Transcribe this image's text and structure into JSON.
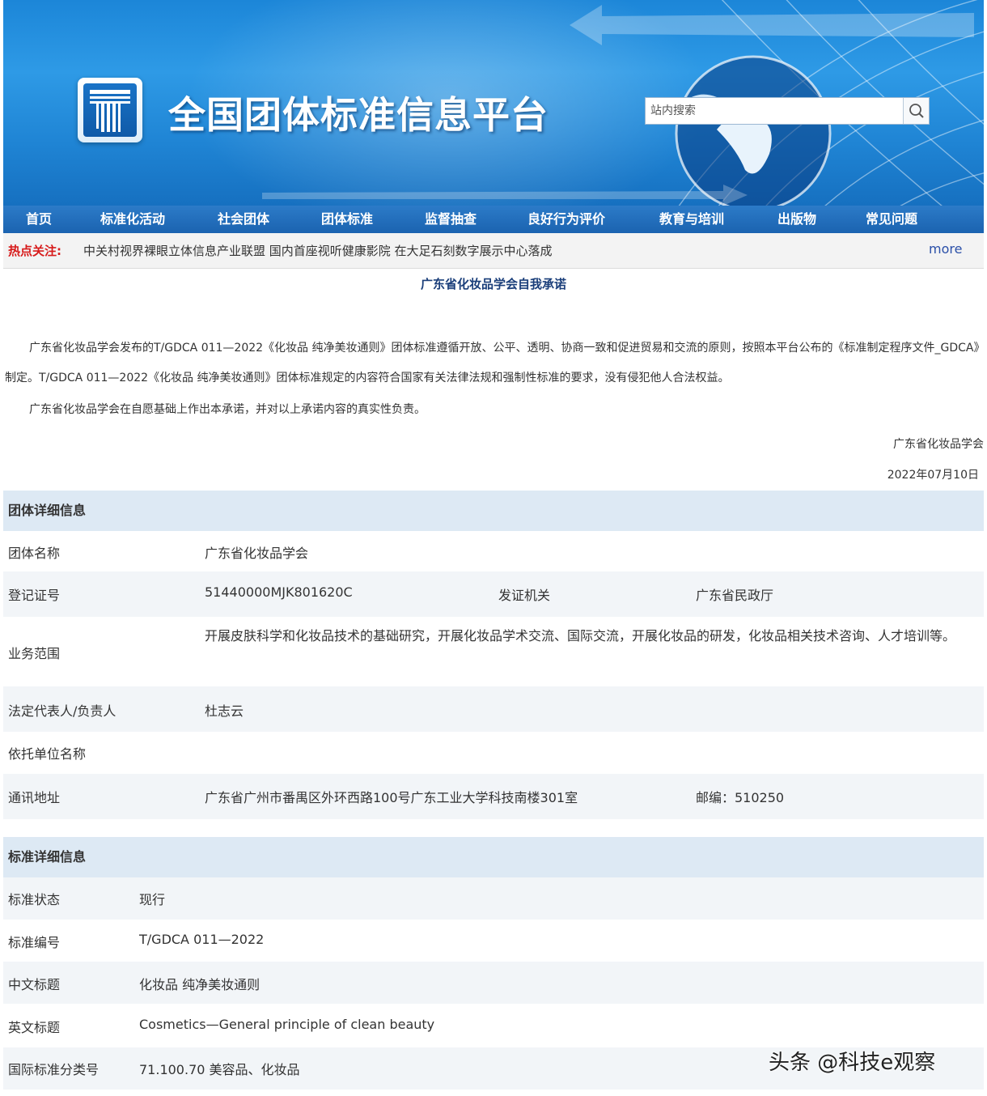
{
  "header": {
    "site_title": "全国团体标准信息平台",
    "search_placeholder": "站内搜索"
  },
  "nav": {
    "items": [
      {
        "label": "首页"
      },
      {
        "label": "标准化活动"
      },
      {
        "label": "社会团体"
      },
      {
        "label": "团体标准"
      },
      {
        "label": "监督抽查"
      },
      {
        "label": "良好行为评价"
      },
      {
        "label": "教育与培训"
      },
      {
        "label": "出版物"
      },
      {
        "label": "常见问题"
      }
    ]
  },
  "hotbar": {
    "label": "热点关注:",
    "text": "中关村视界裸眼立体信息产业联盟 国内首座视听健康影院 在大足石刻数字展示中心落成",
    "more": "more"
  },
  "promise": {
    "title": "广东省化妆品学会自我承诺",
    "para1": "广东省化妆品学会发布的T/GDCA 011—2022《化妆品 纯净美妆通则》团体标准遵循开放、公平、透明、协商一致和促进贸易和交流的原则，按照本平台公布的《标准制定程序文件_GDCA》制定。T/GDCA 011—2022《化妆品 纯净美妆通则》团体标准规定的内容符合国家有关法律法规和强制性标准的要求，没有侵犯他人合法权益。",
    "para2": "广东省化妆品学会在自愿基础上作出本承诺，并对以上承诺内容的真实性负责。",
    "signature": "广东省化妆品学会",
    "date": "2022年07月10日"
  },
  "org": {
    "section_title": "团体详细信息",
    "name_label": "团体名称",
    "name": "广东省化妆品学会",
    "reg_label": "登记证号",
    "reg": "51440000MJK801620C",
    "issuer_label": "发证机关",
    "issuer": "广东省民政厅",
    "scope_label": "业务范围",
    "scope": "开展皮肤科学和化妆品技术的基础研究，开展化妆品学术交流、国际交流，开展化妆品的研发，化妆品相关技术咨询、人才培训等。",
    "rep_label": "法定代表人/负责人",
    "rep": "杜志云",
    "sponsor_label": "依托单位名称",
    "sponsor": "",
    "address_label": "通讯地址",
    "address": "广东省广州市番禺区外环西路100号广东工业大学科技南楼301室",
    "postcode": "邮编：510250"
  },
  "standard": {
    "section_title": "标准详细信息",
    "status_label": "标准状态",
    "status": "现行",
    "number_label": "标准编号",
    "number": "T/GDCA 011—2022",
    "cn_title_label": "中文标题",
    "cn_title": "化妆品 纯净美妆通则",
    "en_title_label": "英文标题",
    "en_title": "Cosmetics—General principle of clean beauty",
    "ics_label": "国际标准分类号",
    "ics": "71.100.70 美容品、化妆品"
  },
  "watermark": "头条 @科技e观察",
  "colors": {
    "nav_bg": "#1b63b0",
    "hot_label": "#d71b1b",
    "section_bg": "#dde9f4",
    "title_blue": "#1a3e7a"
  }
}
